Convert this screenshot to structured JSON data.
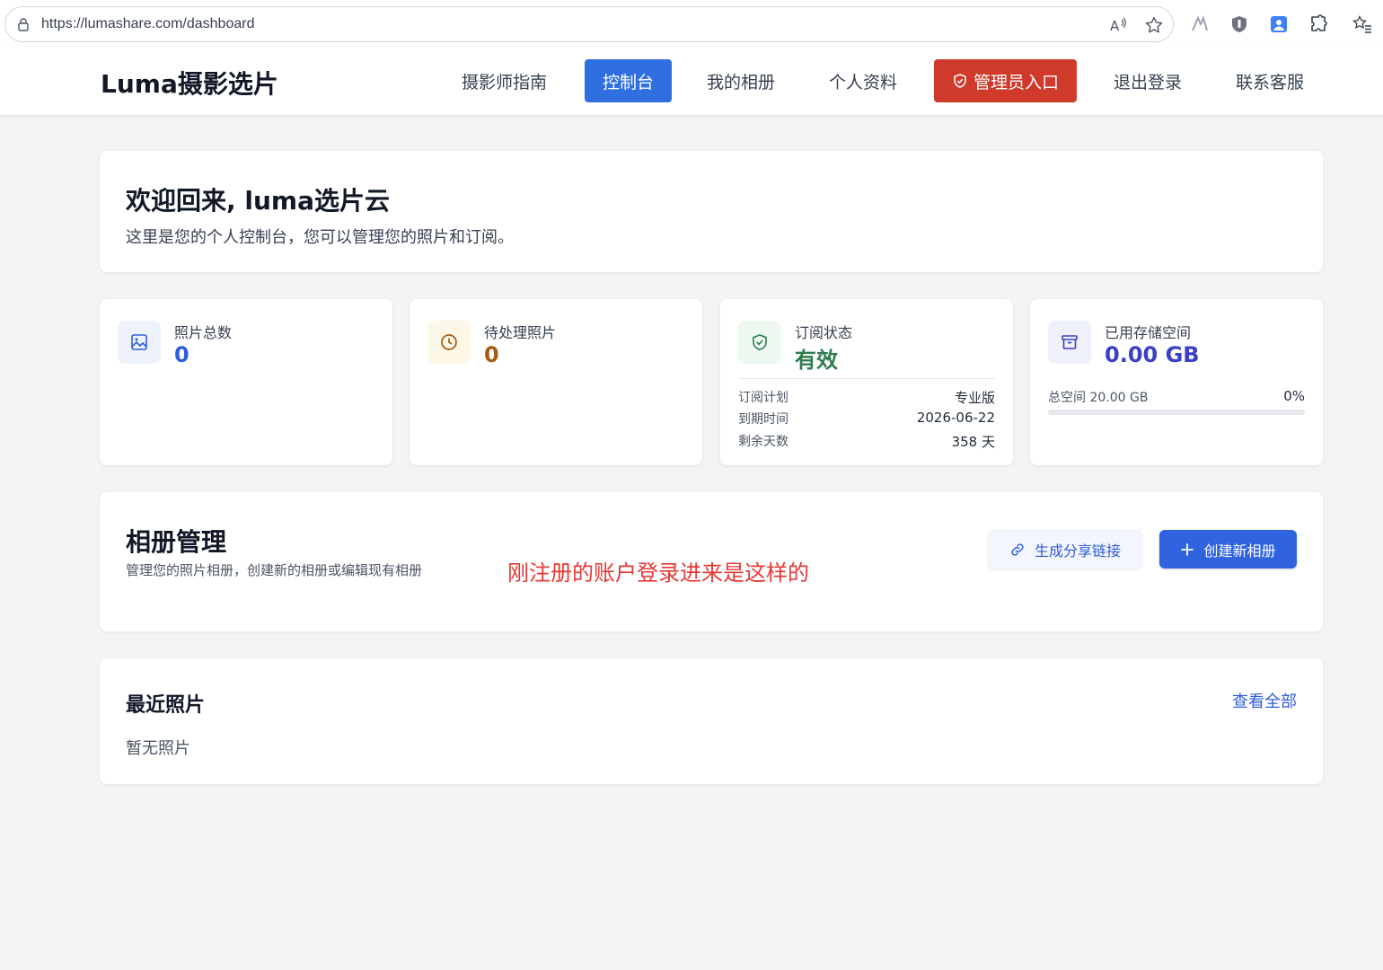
{
  "browser": {
    "url": "https://lumashare.com/dashboard"
  },
  "nav": {
    "brand": "Luma摄影选片",
    "items": [
      {
        "label": "摄影师指南"
      },
      {
        "label": "控制台"
      },
      {
        "label": "我的相册"
      },
      {
        "label": "个人资料"
      },
      {
        "label": "管理员入口"
      },
      {
        "label": "退出登录"
      },
      {
        "label": "联系客服"
      }
    ]
  },
  "welcome": {
    "title": "欢迎回来, luma选片云",
    "subtitle": "这里是您的个人控制台，您可以管理您的照片和订阅。"
  },
  "stats": {
    "photos": {
      "label": "照片总数",
      "value": "0"
    },
    "pending": {
      "label": "待处理照片",
      "value": "0"
    },
    "subscription": {
      "label": "订阅状态",
      "value": "有效",
      "plan_label": "订阅计划",
      "plan_value": "专业版",
      "expire_label": "到期时间",
      "expire_value": "2026-06-22",
      "days_label": "剩余天数",
      "days_value": "358 天"
    },
    "storage": {
      "label": "已用存储空间",
      "value": "0.00 GB",
      "total_label": "总空间 20.00 GB",
      "percent_label": "0%",
      "used_fraction": 0
    }
  },
  "album": {
    "title": "相册管理",
    "subtitle": "管理您的照片相册，创建新的相册或编辑现有相册",
    "note": "刚注册的账户登录进来是这样的",
    "share_label": "生成分享链接",
    "create_label": "创建新相册"
  },
  "recent": {
    "title": "最近照片",
    "view_all": "查看全部",
    "empty": "暂无照片"
  },
  "colors": {
    "primary": "#2f6fe0",
    "admin": "#cf3a2b",
    "photos_value": "#2f5cd9",
    "pending_value": "#a55b12",
    "active_value": "#2e7d4f",
    "storage_value": "#3b3fc4",
    "note": "#e53935"
  }
}
